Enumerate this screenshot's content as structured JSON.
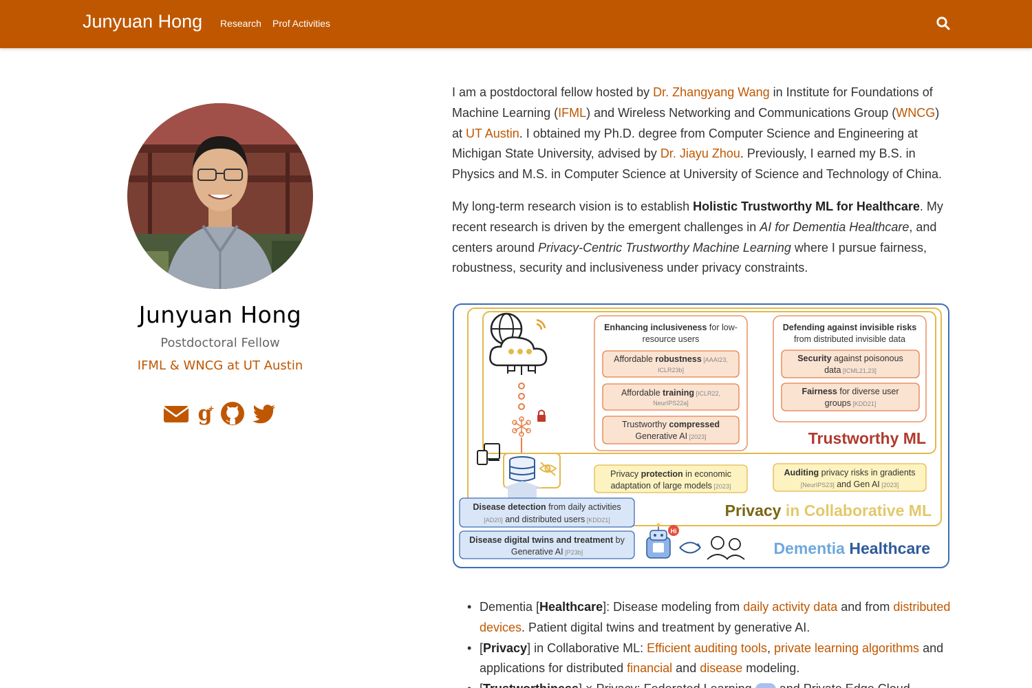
{
  "navbar": {
    "brand": "Junyuan Hong",
    "links": [
      "Research",
      "Prof Activities"
    ],
    "search_icon": "search-icon"
  },
  "sidebar": {
    "name": "Junyuan Hong",
    "role": "Postdoctoral Fellow",
    "affiliation": "IFML & WNCG at UT Austin",
    "social_icons": [
      "envelope-icon",
      "google-scholar-icon",
      "github-icon",
      "twitter-icon"
    ]
  },
  "bio": {
    "p1": {
      "t1": "I am a postdoctoral fellow hosted by ",
      "l1": "Dr. Zhangyang Wang",
      "t2": " in Institute for Foundations of Machine Learning (",
      "l2": "IFML",
      "t3": ") and Wireless Networking and Communications Group (",
      "l3": "WNCG",
      "t4": ") at ",
      "l4": "UT Austin",
      "t5": ". I obtained my Ph.D. degree from Computer Science and Engineering at Michigan State University, advised by ",
      "l5": "Dr. Jiayu Zhou",
      "t6": ". Previously, I earned my B.S. in Physics and M.S. in Computer Science at University of Science and Technology of China."
    },
    "p2": {
      "t1": "My long-term research vision is to establish ",
      "b1": "Holistic Trustworthy ML for Healthcare",
      "t2": ". My recent research is driven by the emergent challenges in ",
      "i1": "AI for Dementia Healthcare",
      "t3": ", and centers around ",
      "i2": "Privacy-Centric Trustworthy Machine Learning",
      "t4": " where I pursue fairness, robustness, security and inclusiveness under privacy constraints."
    }
  },
  "figure": {
    "inclusive_title_bold": "Enhancing inclusiveness",
    "inclusive_title_rest": " for low-",
    "inclusive_title_line2": "resource users",
    "box_robust_1": "Affordable ",
    "box_robust_b": "robustness",
    "box_robust_ref": " [AAAI23,",
    "box_robust_ref2": "ICLR23b]",
    "box_train_1": "Affordable ",
    "box_train_b": "training",
    "box_train_ref": " [ICLR22,",
    "box_train_ref2": "NeurIPS22a]",
    "box_comp_1": "Trustworthy ",
    "box_comp_b": "compressed",
    "box_comp_2": "Generative AI",
    "box_comp_ref": " [2023]",
    "defend_title_1": "Defending against invisible risks",
    "defend_title_2": "from distributed invisible data",
    "box_sec_b": "Security",
    "box_sec_1": " against poisonous",
    "box_sec_2": "data",
    "box_sec_ref": " [ICML21,23]",
    "box_fair_b": "Fairness",
    "box_fair_1": " for diverse user",
    "box_fair_2": "groups",
    "box_fair_ref": " [KDD21]",
    "trust_label": "Trustworthy ML",
    "box_priv_1": "Privacy ",
    "box_priv_b": "protection",
    "box_priv_2": " in economic",
    "box_priv_3": "adaptation of large models",
    "box_priv_ref": " [2023]",
    "box_audit_b": "Auditing",
    "box_audit_1": " privacy risks in gradients",
    "box_audit_ref": "[NeurIPS23]",
    "box_audit_2": " and Gen AI",
    "box_audit_ref2": " [2023]",
    "privacy_label_1": "Privacy",
    "privacy_label_2": " in Collaborative ML",
    "box_detect_b": "Disease detection",
    "box_detect_1": " from daily activities",
    "box_detect_ref": "[AD20]",
    "box_detect_2": " and distributed users",
    "box_detect_ref2": " [KDD21]",
    "box_twin_b": "Disease digital twins and treatment",
    "box_twin_1": " by",
    "box_twin_2": "Generative AI",
    "box_twin_ref": " [P23b]",
    "hi_badge": "Hi",
    "dementia_1": "Dementia ",
    "dementia_2": "Healthcare"
  },
  "bullets": [
    {
      "t1": "Dementia [",
      "b1": "Healthcare",
      "t2": "]: Disease modeling from ",
      "l1": "daily activity data",
      "t3": " and from ",
      "l2": "distributed devices",
      "t4": ". Patient digital twins and treatment by generative AI."
    },
    {
      "t1": "[",
      "b1": "Privacy",
      "t2": "] in Collaborative ML: ",
      "l1": "Efficient auditing tools",
      "t3": ", ",
      "l2": "private learning algorithms",
      "t4": " and applications for distributed ",
      "l3": "financial",
      "t5": " and ",
      "l4": "disease",
      "t6": " modeling."
    },
    {
      "t1": "[",
      "b1": "Trustworthiness",
      "t2": "] × Privacy: Federated Learning ",
      "t3": " and Private Edge Cloud"
    }
  ],
  "colors": {
    "brand": "#bf5700",
    "figure_yellow": "#e3b94b",
    "figure_blue": "#3e6db5",
    "trust_red": "#b03a2e"
  }
}
